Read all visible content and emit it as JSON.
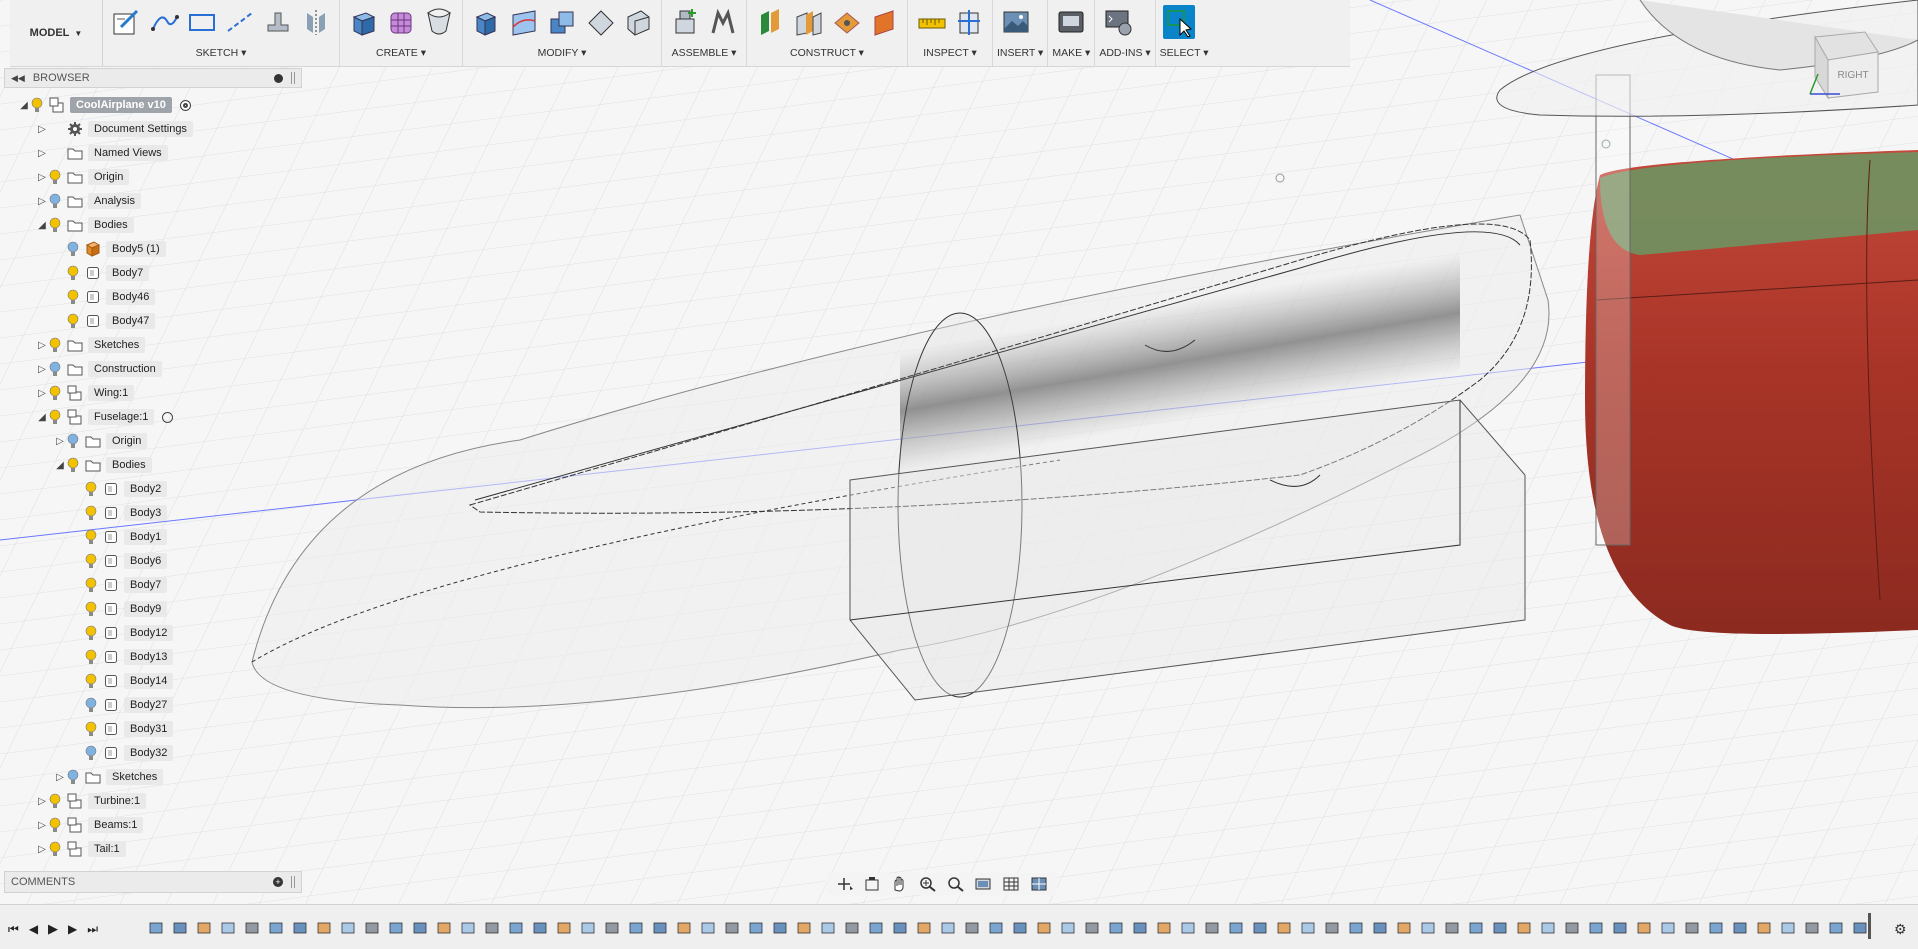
{
  "toolbar": {
    "model_label": "MODEL",
    "groups": [
      {
        "label": "SKETCH ▾",
        "icons": [
          "sketch-create-icon",
          "spline-icon",
          "rectangle-icon",
          "construction-line-icon",
          "project-icon",
          "mirror-sketch-icon"
        ]
      },
      {
        "label": "CREATE ▾",
        "icons": [
          "box-icon",
          "form-mesh-icon",
          "revolve-icon"
        ]
      },
      {
        "label": "MODIFY ▾",
        "icons": [
          "press-pull-icon",
          "surface-icon",
          "combine-icon",
          "fillet-icon",
          "shell-icon"
        ]
      },
      {
        "label": "ASSEMBLE ▾",
        "icons": [
          "new-component-icon",
          "joint-icon"
        ]
      },
      {
        "label": "CONSTRUCT ▾",
        "icons": [
          "offset-plane-icon",
          "midplane-icon",
          "plane-through-points-icon",
          "plane-at-angle-icon"
        ]
      },
      {
        "label": "INSPECT ▾",
        "icons": [
          "measure-icon",
          "section-analysis-icon"
        ]
      },
      {
        "label": "INSERT ▾",
        "icons": [
          "insert-canvas-icon"
        ]
      },
      {
        "label": "MAKE ▾",
        "icons": [
          "3d-print-icon"
        ]
      },
      {
        "label": "ADD-INS ▾",
        "icons": [
          "scripts-addins-icon"
        ]
      },
      {
        "label": "SELECT ▾",
        "icons": [
          "select-cursor-icon"
        ]
      }
    ]
  },
  "browser": {
    "title": "BROWSER",
    "items": [
      {
        "label": "CoolAirplane v10",
        "level": 0,
        "expander": "expanded",
        "bulb": "on",
        "icon": "document-icon",
        "selected": true,
        "radio": true
      },
      {
        "label": "Document Settings",
        "level": 1,
        "expander": "collapsed",
        "bulb": "none",
        "icon": "gear-icon"
      },
      {
        "label": "Named Views",
        "level": 1,
        "expander": "collapsed",
        "bulb": "none",
        "icon": "folder-icon"
      },
      {
        "label": "Origin",
        "level": 1,
        "expander": "collapsed",
        "bulb": "on",
        "icon": "folder-icon"
      },
      {
        "label": "Analysis",
        "level": 1,
        "expander": "collapsed",
        "bulb": "off",
        "icon": "folder-icon"
      },
      {
        "label": "Bodies",
        "level": 1,
        "expander": "expanded",
        "bulb": "on",
        "icon": "folder-icon"
      },
      {
        "label": "Body5 (1)",
        "level": 2,
        "expander": "none",
        "bulb": "off",
        "icon": "body-orange-icon"
      },
      {
        "label": "Body7",
        "level": 2,
        "expander": "none",
        "bulb": "on",
        "icon": "body-icon"
      },
      {
        "label": "Body46",
        "level": 2,
        "expander": "none",
        "bulb": "on",
        "icon": "body-icon"
      },
      {
        "label": "Body47",
        "level": 2,
        "expander": "none",
        "bulb": "on",
        "icon": "body-icon"
      },
      {
        "label": "Sketches",
        "level": 1,
        "expander": "collapsed",
        "bulb": "on",
        "icon": "folder-icon"
      },
      {
        "label": "Construction",
        "level": 1,
        "expander": "collapsed",
        "bulb": "off",
        "icon": "folder-icon"
      },
      {
        "label": "Wing:1",
        "level": 1,
        "expander": "collapsed",
        "bulb": "on",
        "icon": "component-icon"
      },
      {
        "label": "Fuselage:1",
        "level": 1,
        "expander": "expanded",
        "bulb": "on",
        "icon": "component-icon",
        "radio": true
      },
      {
        "label": "Origin",
        "level": 2,
        "expander": "collapsed",
        "bulb": "off",
        "icon": "folder-icon"
      },
      {
        "label": "Bodies",
        "level": 2,
        "expander": "expanded",
        "bulb": "on",
        "icon": "folder-icon"
      },
      {
        "label": "Body2",
        "level": 3,
        "expander": "none",
        "bulb": "on",
        "icon": "body-icon"
      },
      {
        "label": "Body3",
        "level": 3,
        "expander": "none",
        "bulb": "on",
        "icon": "body-icon"
      },
      {
        "label": "Body1",
        "level": 3,
        "expander": "none",
        "bulb": "on",
        "icon": "body-icon"
      },
      {
        "label": "Body6",
        "level": 3,
        "expander": "none",
        "bulb": "on",
        "icon": "body-icon"
      },
      {
        "label": "Body7",
        "level": 3,
        "expander": "none",
        "bulb": "on",
        "icon": "body-icon"
      },
      {
        "label": "Body9",
        "level": 3,
        "expander": "none",
        "bulb": "on",
        "icon": "body-icon"
      },
      {
        "label": "Body12",
        "level": 3,
        "expander": "none",
        "bulb": "on",
        "icon": "body-icon"
      },
      {
        "label": "Body13",
        "level": 3,
        "expander": "none",
        "bulb": "on",
        "icon": "body-icon"
      },
      {
        "label": "Body14",
        "level": 3,
        "expander": "none",
        "bulb": "on",
        "icon": "body-icon"
      },
      {
        "label": "Body27",
        "level": 3,
        "expander": "none",
        "bulb": "off",
        "icon": "body-icon"
      },
      {
        "label": "Body31",
        "level": 3,
        "expander": "none",
        "bulb": "on",
        "icon": "body-icon"
      },
      {
        "label": "Body32",
        "level": 3,
        "expander": "none",
        "bulb": "off",
        "icon": "body-icon"
      },
      {
        "label": "Sketches",
        "level": 2,
        "expander": "collapsed",
        "bulb": "off",
        "icon": "folder-icon"
      },
      {
        "label": "Turbine:1",
        "level": 1,
        "expander": "collapsed",
        "bulb": "on",
        "icon": "component-icon"
      },
      {
        "label": "Beams:1",
        "level": 1,
        "expander": "collapsed",
        "bulb": "on",
        "icon": "component-icon"
      },
      {
        "label": "Tail:1",
        "level": 1,
        "expander": "collapsed",
        "bulb": "on",
        "icon": "component-icon"
      }
    ]
  },
  "comments": {
    "title": "COMMENTS"
  },
  "viewcube": {
    "face_label": "RIGHT"
  },
  "navbar": {
    "icons": [
      "orbit-icon",
      "look-at-icon",
      "pan-icon",
      "zoom-icon",
      "fit-icon",
      "display-settings-icon",
      "grid-settings-icon",
      "viewports-icon"
    ]
  },
  "timeline": {
    "controls": [
      "go-to-start-icon",
      "step-back-icon",
      "play-icon",
      "step-forward-icon",
      "go-to-end-icon"
    ],
    "feature_count": 72
  },
  "colors": {
    "accent": "#0a84c8",
    "bulb_on": "#f2c200",
    "bulb_off": "#7fb2e0",
    "body_red": "#b13a2a",
    "body_green": "#6b8d5a",
    "axis_blue": "#4a5cff"
  }
}
